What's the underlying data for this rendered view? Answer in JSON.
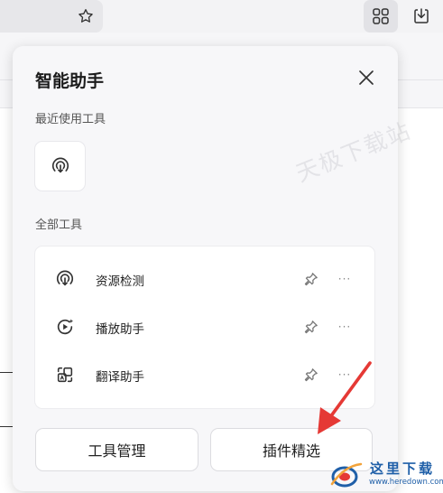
{
  "panel": {
    "title": "智能助手",
    "recent_label": "最近使用工具",
    "all_label": "全部工具",
    "tools": [
      {
        "name": "资源检测",
        "icon": "podcast-broadcast-icon"
      },
      {
        "name": "播放助手",
        "icon": "play-sparkle-icon"
      },
      {
        "name": "翻译助手",
        "icon": "translate-icon"
      }
    ],
    "more_glyph": "···",
    "manage_label": "工具管理",
    "plugins_label": "插件精选"
  },
  "watermark": "天极下载站",
  "logo": {
    "cn": "这里下载",
    "en": "www.heredown.com"
  },
  "colors": {
    "panel_bg": "#f7f7f9",
    "annotation_arrow": "#e53935",
    "logo_blue": "#1f5fa8"
  }
}
